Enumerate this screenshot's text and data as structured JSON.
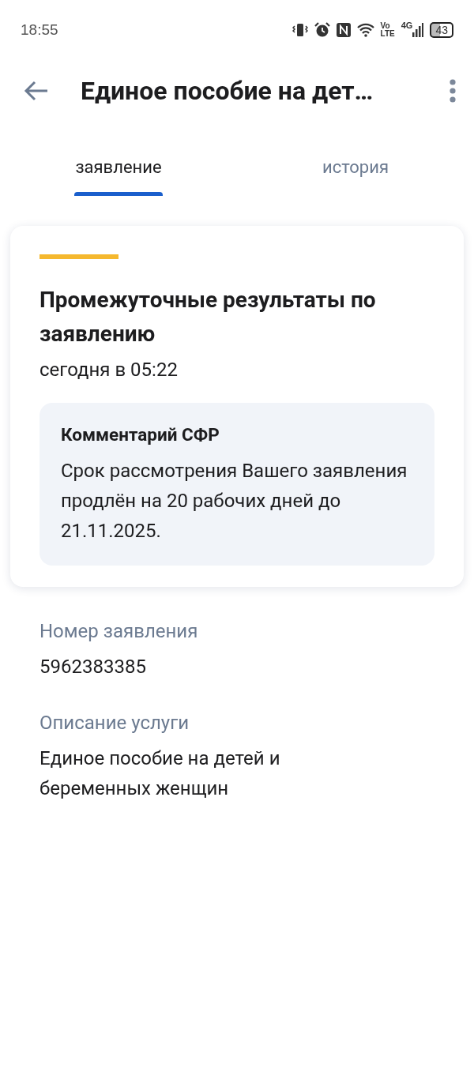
{
  "status_bar": {
    "time": "18:55",
    "volte": [
      "Vo",
      "LTE"
    ],
    "network": "4G",
    "battery": "43"
  },
  "header": {
    "title": "Единое пособие на дет…"
  },
  "tabs": [
    {
      "label": "заявление",
      "selected": true
    },
    {
      "label": "история",
      "selected": false
    }
  ],
  "card": {
    "title": "Промежуточные результаты по заявлению",
    "date": "сегодня в 05:22",
    "comment": {
      "title": "Комментарий СФР",
      "text": "Срок рассмотрения Вашего заявления продлён на 20 рабочих дней до 21.11.2025."
    }
  },
  "fields": [
    {
      "label": "Номер заявления",
      "value": "5962383385"
    },
    {
      "label": "Описание услуги",
      "value": "Единое пособие на детей и беременных женщин"
    }
  ]
}
